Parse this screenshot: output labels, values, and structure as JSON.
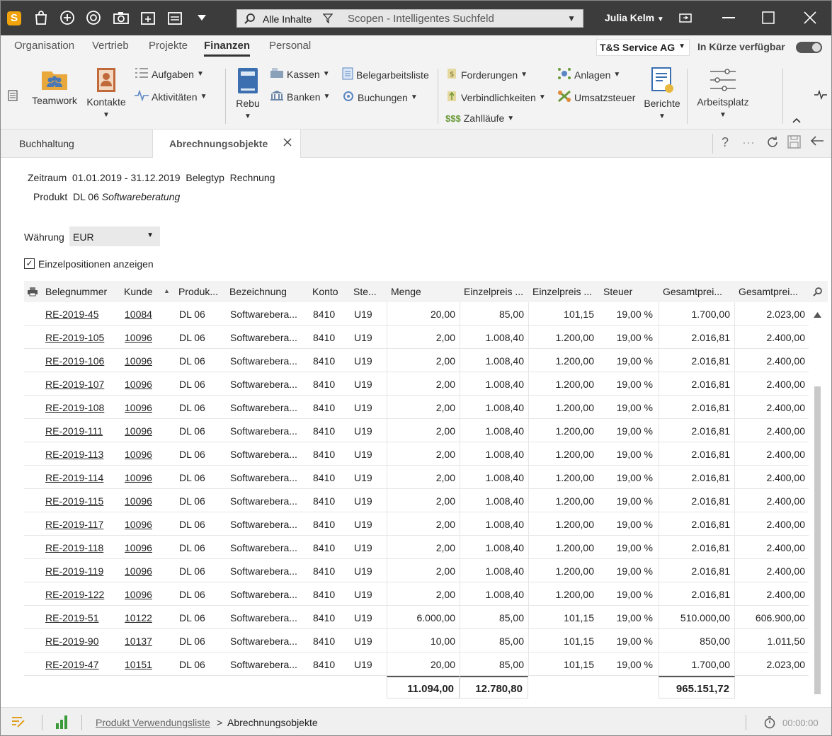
{
  "titlebar": {
    "search_scope": "Alle Inhalte",
    "search_placeholder": "Scopen - Intelligentes Suchfeld",
    "user": "Julia Kelm"
  },
  "menu": {
    "tabs": [
      "Organisation",
      "Vertrieb",
      "Projekte",
      "Finanzen",
      "Personal"
    ],
    "active": "Finanzen",
    "company": "T&S Service AG",
    "coming_soon": "In Kürze verfügbar"
  },
  "ribbon": {
    "teamwork": "Teamwork",
    "kontakte": "Kontakte",
    "aufgaben": "Aufgaben",
    "aktivitaeten": "Aktivitäten",
    "rebu": "Rebu",
    "kassen": "Kassen",
    "banken": "Banken",
    "belegarbeitsliste": "Belegarbeitsliste",
    "buchungen": "Buchungen",
    "forderungen": "Forderungen",
    "verbindlichkeiten": "Verbindlichkeiten",
    "zahllaeufe": "Zahlläufe",
    "anlagen": "Anlagen",
    "umsatzsteuer": "Umsatzsteuer",
    "berichte": "Berichte",
    "arbeitsplatz": "Arbeitsplatz"
  },
  "doc_tabs": {
    "buchhaltung": "Buchhaltung",
    "abrechnungsobjekte": "Abrechnungsobjekte"
  },
  "filters": {
    "zeitraum_label": "Zeitraum",
    "zeitraum_value": "01.01.2019 - 31.12.2019",
    "belegtyp_label": "Belegtyp",
    "belegtyp_value": "Rechnung",
    "produkt_label": "Produkt",
    "produkt_code": "DL 06",
    "produkt_name": "Softwareberatung",
    "waehrung_label": "Währung",
    "waehrung_value": "EUR",
    "einzel_label": "Einzelpositionen anzeigen"
  },
  "grid": {
    "headers": [
      "Belegnummer",
      "Kunde",
      "Produk...",
      "Bezeichnung",
      "Konto",
      "Ste...",
      "Menge",
      "Einzelpreis ...",
      "Einzelpreis ...",
      "Steuer",
      "Gesamtprei...",
      "Gesamtprei..."
    ],
    "rows": [
      [
        "RE-2019-45",
        "10084",
        "DL 06",
        "Softwarebera...",
        "8410",
        "U19",
        "20,00",
        "85,00",
        "101,15",
        "19,00 %",
        "1.700,00",
        "2.023,00"
      ],
      [
        "RE-2019-105",
        "10096",
        "DL 06",
        "Softwarebera...",
        "8410",
        "U19",
        "2,00",
        "1.008,40",
        "1.200,00",
        "19,00 %",
        "2.016,81",
        "2.400,00"
      ],
      [
        "RE-2019-106",
        "10096",
        "DL 06",
        "Softwarebera...",
        "8410",
        "U19",
        "2,00",
        "1.008,40",
        "1.200,00",
        "19,00 %",
        "2.016,81",
        "2.400,00"
      ],
      [
        "RE-2019-107",
        "10096",
        "DL 06",
        "Softwarebera...",
        "8410",
        "U19",
        "2,00",
        "1.008,40",
        "1.200,00",
        "19,00 %",
        "2.016,81",
        "2.400,00"
      ],
      [
        "RE-2019-108",
        "10096",
        "DL 06",
        "Softwarebera...",
        "8410",
        "U19",
        "2,00",
        "1.008,40",
        "1.200,00",
        "19,00 %",
        "2.016,81",
        "2.400,00"
      ],
      [
        "RE-2019-111",
        "10096",
        "DL 06",
        "Softwarebera...",
        "8410",
        "U19",
        "2,00",
        "1.008,40",
        "1.200,00",
        "19,00 %",
        "2.016,81",
        "2.400,00"
      ],
      [
        "RE-2019-113",
        "10096",
        "DL 06",
        "Softwarebera...",
        "8410",
        "U19",
        "2,00",
        "1.008,40",
        "1.200,00",
        "19,00 %",
        "2.016,81",
        "2.400,00"
      ],
      [
        "RE-2019-114",
        "10096",
        "DL 06",
        "Softwarebera...",
        "8410",
        "U19",
        "2,00",
        "1.008,40",
        "1.200,00",
        "19,00 %",
        "2.016,81",
        "2.400,00"
      ],
      [
        "RE-2019-115",
        "10096",
        "DL 06",
        "Softwarebera...",
        "8410",
        "U19",
        "2,00",
        "1.008,40",
        "1.200,00",
        "19,00 %",
        "2.016,81",
        "2.400,00"
      ],
      [
        "RE-2019-117",
        "10096",
        "DL 06",
        "Softwarebera...",
        "8410",
        "U19",
        "2,00",
        "1.008,40",
        "1.200,00",
        "19,00 %",
        "2.016,81",
        "2.400,00"
      ],
      [
        "RE-2019-118",
        "10096",
        "DL 06",
        "Softwarebera...",
        "8410",
        "U19",
        "2,00",
        "1.008,40",
        "1.200,00",
        "19,00 %",
        "2.016,81",
        "2.400,00"
      ],
      [
        "RE-2019-119",
        "10096",
        "DL 06",
        "Softwarebera...",
        "8410",
        "U19",
        "2,00",
        "1.008,40",
        "1.200,00",
        "19,00 %",
        "2.016,81",
        "2.400,00"
      ],
      [
        "RE-2019-122",
        "10096",
        "DL 06",
        "Softwarebera...",
        "8410",
        "U19",
        "2,00",
        "1.008,40",
        "1.200,00",
        "19,00 %",
        "2.016,81",
        "2.400,00"
      ],
      [
        "RE-2019-51",
        "10122",
        "DL 06",
        "Softwarebera...",
        "8410",
        "U19",
        "6.000,00",
        "85,00",
        "101,15",
        "19,00 %",
        "510.000,00",
        "606.900,00"
      ],
      [
        "RE-2019-90",
        "10137",
        "DL 06",
        "Softwarebera...",
        "8410",
        "U19",
        "10,00",
        "85,00",
        "101,15",
        "19,00 %",
        "850,00",
        "1.011,50"
      ],
      [
        "RE-2019-47",
        "10151",
        "DL 06",
        "Softwarebera...",
        "8410",
        "U19",
        "20,00",
        "85,00",
        "101,15",
        "19,00 %",
        "1.700,00",
        "2.023,00"
      ]
    ],
    "totals": {
      "menge": "11.094,00",
      "einzelpreis": "12.780,80",
      "gesamtpreis": "965.151,72"
    }
  },
  "statusbar": {
    "breadcrumb_link": "Produkt Verwendungsliste",
    "breadcrumb_sep": ">",
    "breadcrumb_current": "Abrechnungsobjekte",
    "timer": "00:00:00"
  },
  "colors": {
    "titlebar": "#3c3c3c",
    "logo": "#f0a30a",
    "ribbon_bg": "#f3f3f3"
  }
}
